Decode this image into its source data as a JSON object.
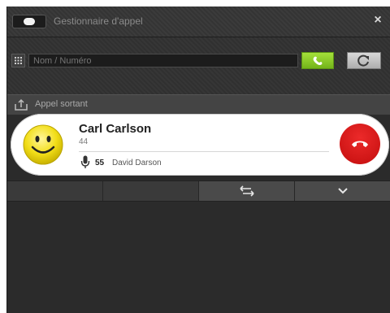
{
  "window": {
    "title": "Gestionnaire d'appel",
    "close_label": "×"
  },
  "search": {
    "placeholder": "Nom / Numéro"
  },
  "call_section": {
    "label": "Appel sortant"
  },
  "call": {
    "name": "Carl Carlson",
    "number": "44",
    "peer_number": "55",
    "peer_name": "David Darson"
  },
  "colors": {
    "call_button": "#8cc92a",
    "hangup_button": "#d81b1b",
    "window_bg": "#2b2b2b"
  },
  "icons": {
    "toggle": "toggle-icon",
    "dialpad": "dialpad-icon",
    "call": "phone-icon",
    "refresh": "refresh-icon",
    "outgoing": "outgoing-call-icon",
    "avatar": "smiley-icon",
    "microphone": "microphone-icon",
    "hangup": "hangup-icon",
    "transfer": "transfer-icon",
    "expand": "chevron-down-icon"
  }
}
